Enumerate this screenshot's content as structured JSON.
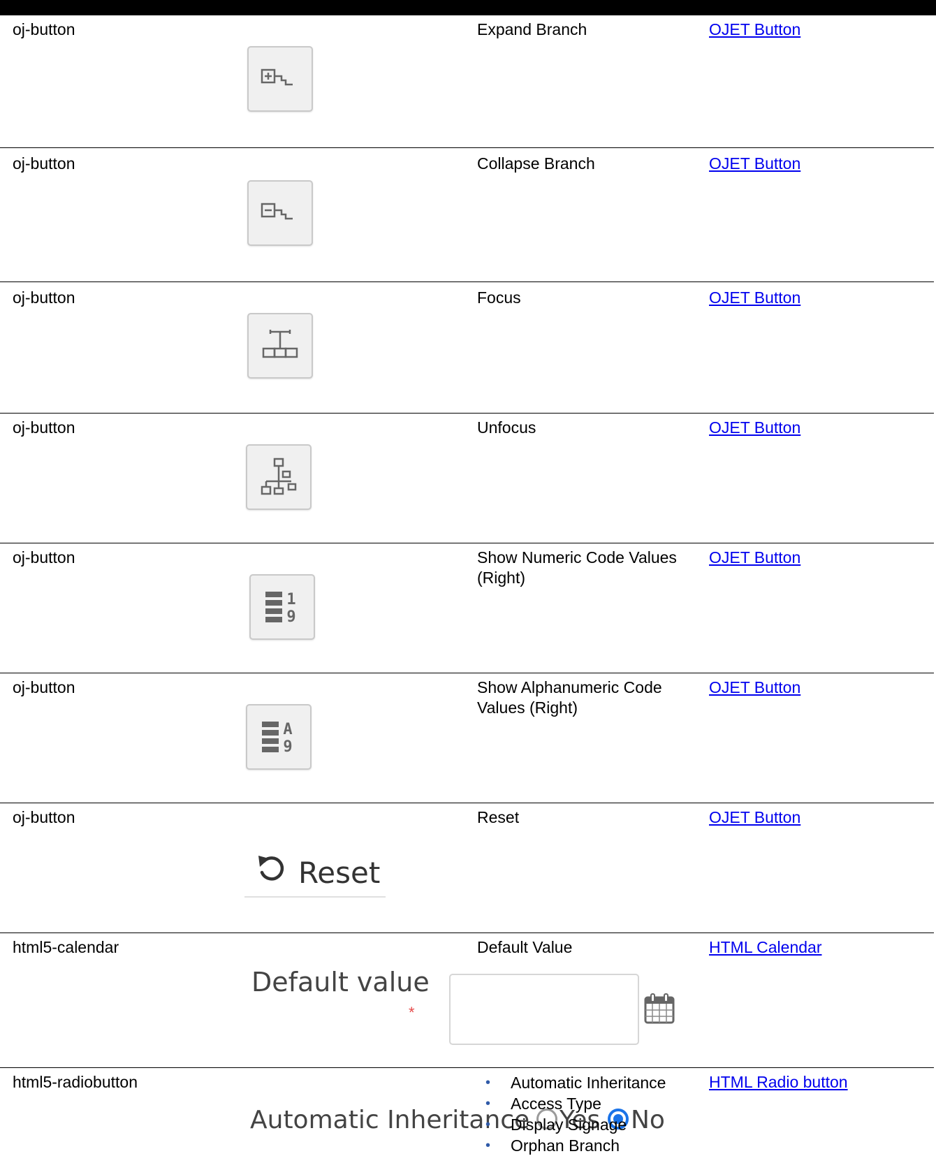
{
  "rows": [
    {
      "component": "oj-button",
      "description": "Expand Branch",
      "link": "OJET Button",
      "icon": "expand-branch-icon"
    },
    {
      "component": "oj-button",
      "description": "Collapse Branch",
      "link": "OJET Button",
      "icon": "collapse-branch-icon"
    },
    {
      "component": "oj-button",
      "description": "Focus",
      "link": "OJET Button",
      "icon": "focus-icon"
    },
    {
      "component": "oj-button",
      "description": "Unfocus",
      "link": "OJET Button",
      "icon": "unfocus-icon"
    },
    {
      "component": "oj-button",
      "description": "Show Numeric Code Values (Right)",
      "link": "OJET Button",
      "icon": "numeric-code-values-icon",
      "icon_glyphs": [
        "1",
        "9"
      ]
    },
    {
      "component": "oj-button",
      "description": "Show Alphanumeric Code Values (Right)",
      "link": "OJET Button",
      "icon": "alphanumeric-code-values-icon",
      "icon_glyphs": [
        "A",
        "9"
      ]
    },
    {
      "component": "oj-button",
      "description": "Reset",
      "link": "OJET Button",
      "icon": "reset-icon",
      "button_label": "Reset"
    },
    {
      "component": "html5-calendar",
      "description": "Default Value",
      "link": "HTML Calendar",
      "icon": "calendar-icon",
      "field_label": "Default value",
      "required_mark": "*",
      "field_value": ""
    },
    {
      "component": "html5-radiobutton",
      "link": "HTML Radio button",
      "field_label": "Automatic Inheritance",
      "options": [
        {
          "label": "Yes",
          "selected": false
        },
        {
          "label": "No",
          "selected": true
        }
      ],
      "bullets": [
        "Automatic Inheritance",
        "Access Type",
        "Display Signage",
        "Orphan Branch"
      ]
    }
  ],
  "colors": {
    "link": "#0000ee",
    "radio_selected": "#1a73e8",
    "required": "#e64a4a",
    "bullet": "#2f5aa8"
  }
}
